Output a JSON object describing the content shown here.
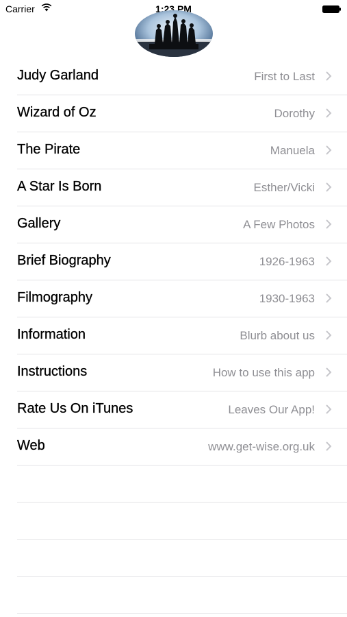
{
  "status_bar": {
    "carrier": "Carrier",
    "time": "1:23 PM"
  },
  "menu": {
    "items": [
      {
        "title": "Judy Garland",
        "detail": "First to Last"
      },
      {
        "title": "Wizard of Oz",
        "detail": "Dorothy"
      },
      {
        "title": "The Pirate",
        "detail": "Manuela"
      },
      {
        "title": "A Star Is Born",
        "detail": "Esther/Vicki"
      },
      {
        "title": "Gallery",
        "detail": "A Few Photos"
      },
      {
        "title": "Brief Biography",
        "detail": "1926-1963"
      },
      {
        "title": "Filmography",
        "detail": "1930-1963"
      },
      {
        "title": "Information",
        "detail": "Blurb about us"
      },
      {
        "title": "Instructions",
        "detail": "How to use this app"
      },
      {
        "title": "Rate Us On iTunes",
        "detail": "Leaves Our App!"
      },
      {
        "title": "Web",
        "detail": "www.get-wise.org.uk"
      }
    ]
  },
  "colors": {
    "detail_text": "#8e8e93",
    "separator": "#e3e3e6",
    "chevron": "#c7c7cc"
  },
  "icons": {
    "status": [
      "wifi-icon",
      "battery-icon"
    ],
    "row_accessory": "chevron-right-icon",
    "header": "statue-silhouette-logo"
  }
}
